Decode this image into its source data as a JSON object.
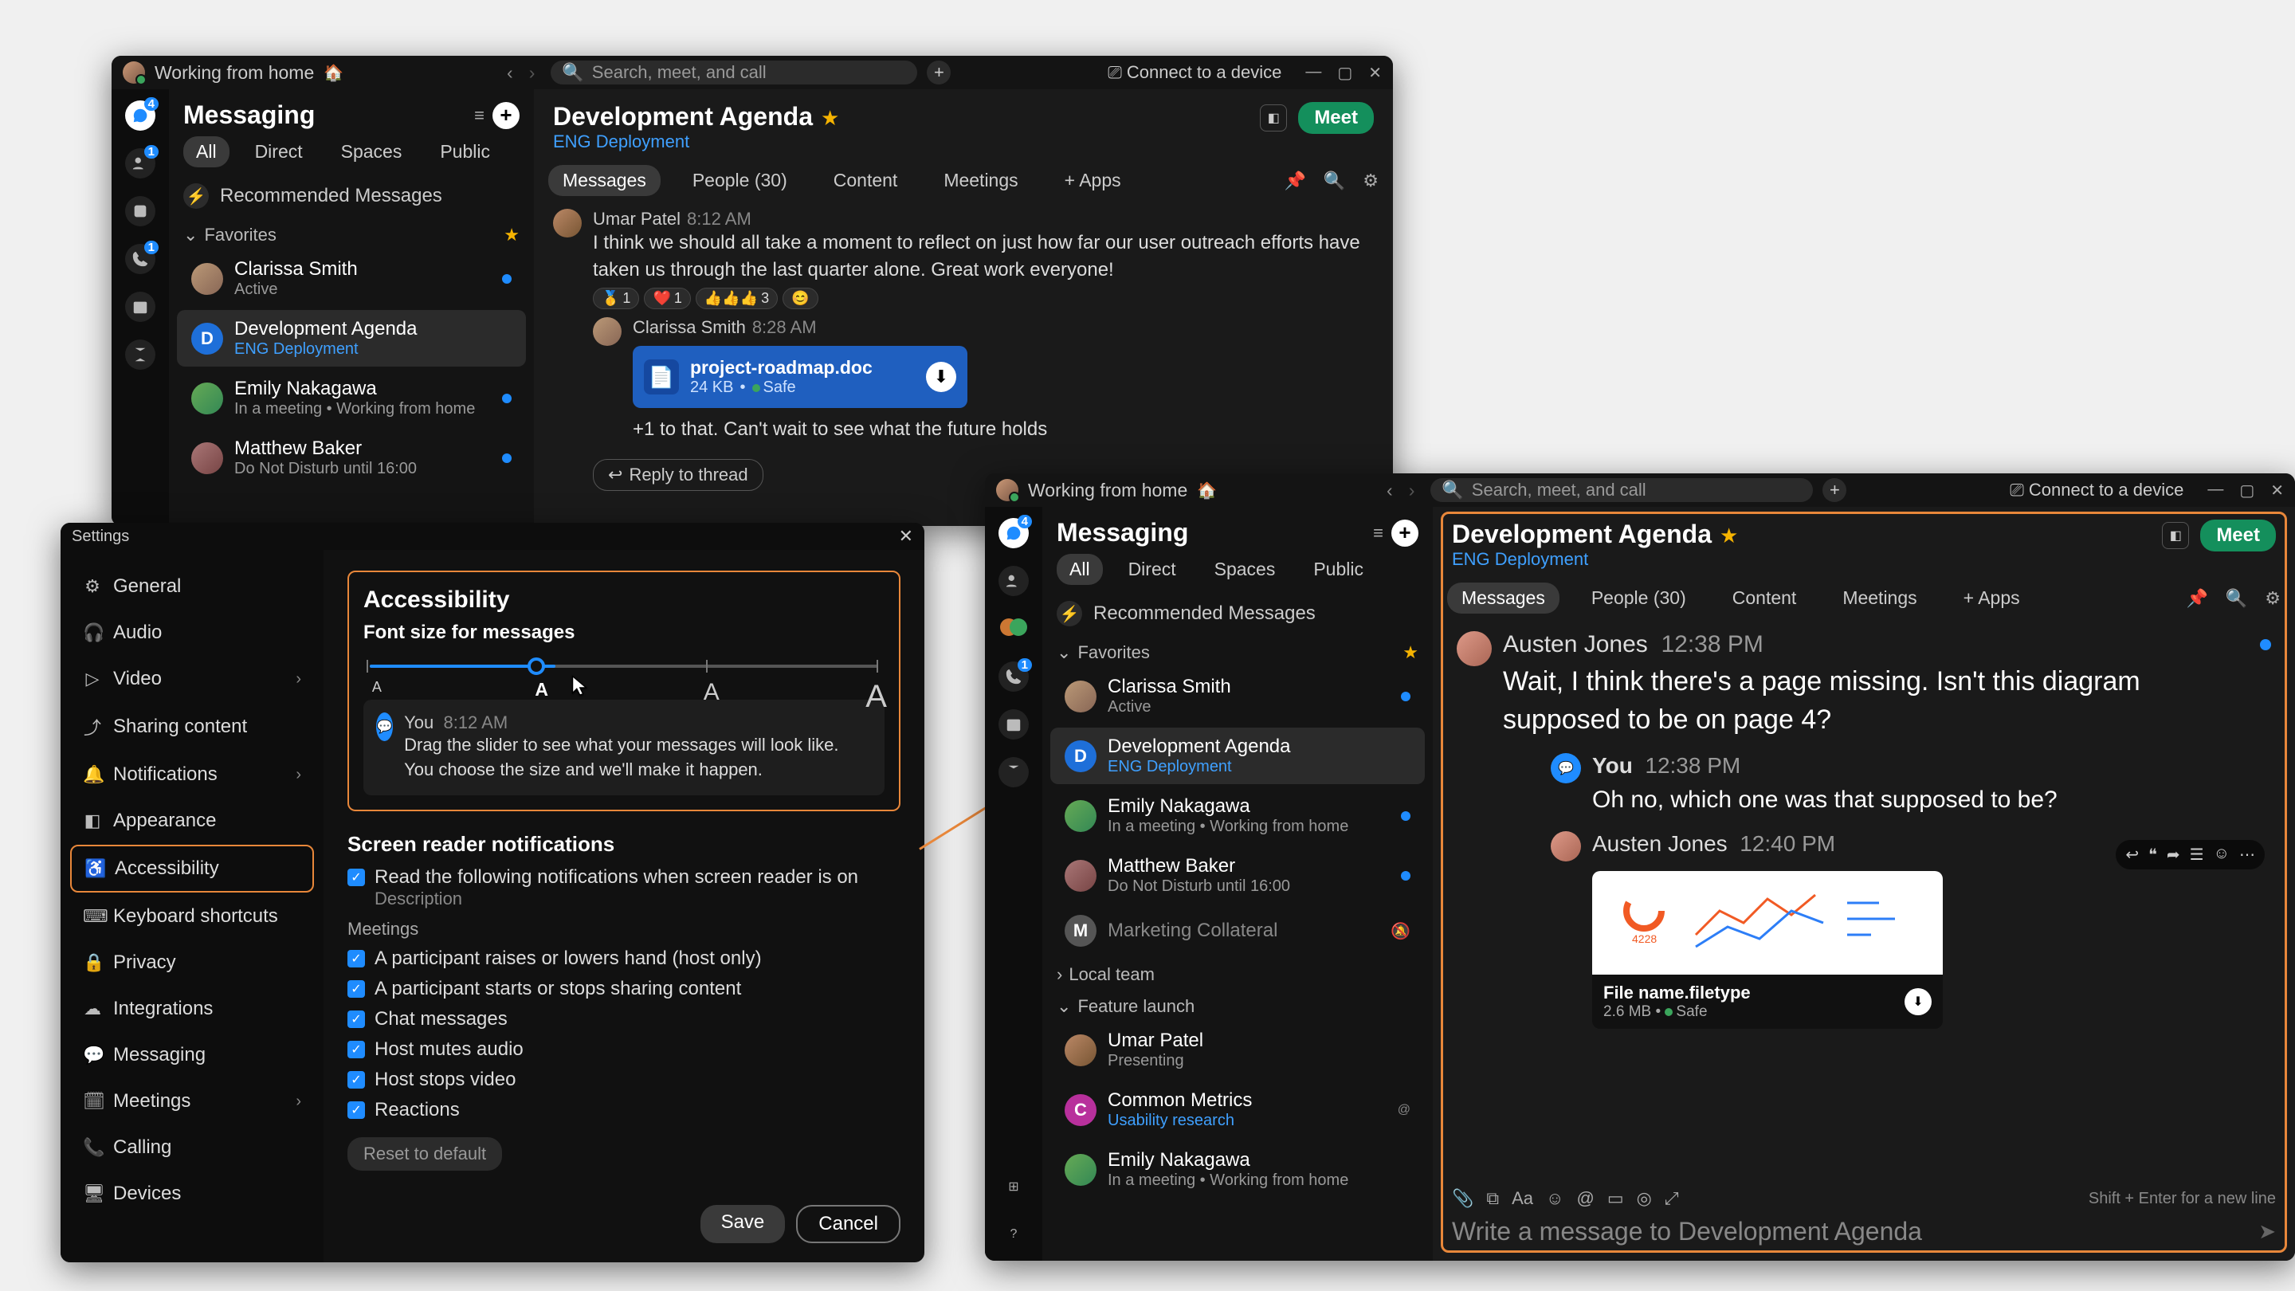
{
  "status_text": "Working from home",
  "status_emoji": "🏠",
  "search_placeholder": "Search, meet, and call",
  "connect_device": "Connect to a device",
  "rail_badges": {
    "chat": "4",
    "contacts": "1",
    "calls": "1"
  },
  "sidebar": {
    "title": "Messaging",
    "filters": [
      "All",
      "Direct",
      "Spaces",
      "Public"
    ],
    "recommended": "Recommended Messages",
    "favorites_label": "Favorites",
    "local_team_label": "Local team",
    "feature_launch_label": "Feature launch",
    "items": [
      {
        "name": "Clarissa Smith",
        "sub": "Active",
        "letter": ""
      },
      {
        "name": "Development Agenda",
        "sub": "ENG Deployment",
        "letter": "D",
        "selected": true,
        "sublink": true
      },
      {
        "name": "Emily Nakagawa",
        "sub": "In a meeting  •  Working from home"
      },
      {
        "name": "Matthew Baker",
        "sub": "Do Not Disturb until 16:00"
      }
    ],
    "items_b_extra": [
      {
        "name": "Marketing Collateral",
        "letter": "M",
        "muted": true
      },
      {
        "name": "Umar Patel",
        "sub": "Presenting"
      },
      {
        "name": "Common Metrics",
        "sub": "Usability research",
        "letter": "C",
        "sublink": true
      },
      {
        "name": "Emily Nakagawa",
        "sub": "In a meeting  •  Working from home"
      }
    ]
  },
  "chatA": {
    "title": "Development Agenda",
    "sub": "ENG Deployment",
    "actions": {
      "meet": "Meet"
    },
    "tabs": [
      "Messages",
      "People (30)",
      "Content",
      "Meetings",
      "+  Apps"
    ],
    "m1": {
      "name": "Umar Patel",
      "time": "8:12 AM",
      "text": "I think we should all take a moment to reflect on just how far our user outreach efforts have taken us through the last quarter alone. Great work everyone!"
    },
    "reactions": [
      [
        "🥇",
        "1"
      ],
      [
        "❤️",
        "1"
      ],
      [
        "👍👍👍",
        "3"
      ],
      [
        "😊",
        ""
      ]
    ],
    "m2": {
      "name": "Clarissa Smith",
      "time": "8:28 AM",
      "file": "project-roadmap.doc",
      "size": "24 KB",
      "safe": "Safe",
      "text": "+1 to that. Can't wait to see what the future holds"
    },
    "reply": "Reply to thread"
  },
  "chatB": {
    "title": "Development Agenda",
    "sub": "ENG Deployment",
    "meet": "Meet",
    "tabs": [
      "Messages",
      "People (30)",
      "Content",
      "Meetings",
      "+  Apps"
    ],
    "m1": {
      "name": "Austen Jones",
      "time": "12:38 PM",
      "text": "Wait, I think there's a page missing. Isn't this diagram supposed to be on page 4?"
    },
    "m2": {
      "name": "You",
      "time": "12:38 PM",
      "text": "Oh no, which one was that supposed to be?"
    },
    "m3": {
      "name": "Austen Jones",
      "time": "12:40 PM",
      "file": "File name.filetype",
      "size": "2.6 MB",
      "safe": "Safe"
    },
    "compose_hint": "Shift + Enter for a new line",
    "compose_placeholder": "Write a message to Development Agenda"
  },
  "settings": {
    "title": "Settings",
    "menu": [
      "General",
      "Audio",
      "Video",
      "Sharing content",
      "Notifications",
      "Appearance",
      "Accessibility",
      "Keyboard shortcuts",
      "Privacy",
      "Integrations",
      "Messaging",
      "Meetings",
      "Calling",
      "Devices"
    ],
    "menu_icons": [
      "⚙",
      "🎧",
      "▷",
      "⤴",
      "🔔",
      "◧",
      "♿",
      "⌨",
      "🔒",
      "☁",
      "💬",
      "🗓",
      "📞",
      "🖥"
    ],
    "heading": "Accessibility",
    "font_label": "Font size for messages",
    "font_marks": [
      "A",
      "A",
      "A",
      "A"
    ],
    "font_sizes": [
      18,
      23,
      30,
      40
    ],
    "preview": {
      "name": "You",
      "time": "8:12 AM",
      "text": "Drag the slider to see what your messages will look like. You choose the size and we'll make it happen."
    },
    "sr_heading": "Screen reader notifications",
    "sr_main": "Read the following notifications when screen reader is on",
    "sr_desc": "Description",
    "meetings_label": "Meetings",
    "checks": [
      "A participant raises or lowers hand (host only)",
      "A participant starts or stops sharing content",
      "Chat messages",
      "Host mutes audio",
      "Host stops video",
      "Reactions"
    ],
    "reset": "Reset to default",
    "save": "Save",
    "cancel": "Cancel"
  }
}
